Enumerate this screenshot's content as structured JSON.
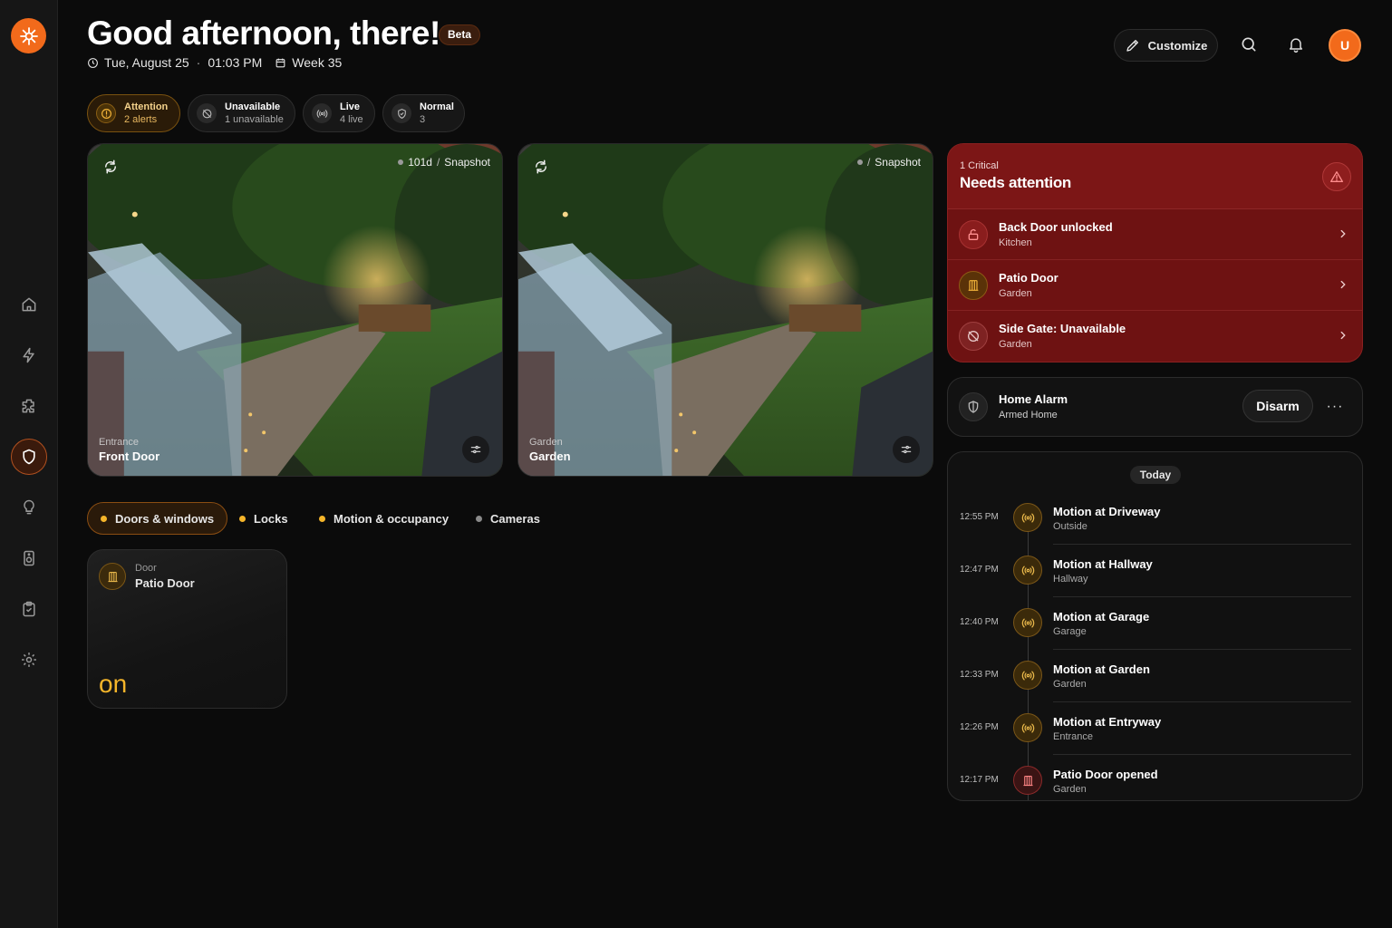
{
  "header": {
    "greeting": "Good afternoon, there!",
    "badge": "Beta",
    "date": "Tue, August 25",
    "time": "01:03 PM",
    "week": "Week 35",
    "customize_label": "Customize",
    "avatar_initial": "U"
  },
  "colors": {
    "accent": "#f26a1b",
    "attention_bg": "#6e1212",
    "amber": "#f5b52a"
  },
  "sidebar": {
    "items": [
      {
        "name": "home",
        "icon": "home-icon"
      },
      {
        "name": "automations",
        "icon": "bolt-icon"
      },
      {
        "name": "integrations",
        "icon": "puzzle-icon"
      },
      {
        "name": "security",
        "icon": "shield-icon",
        "active": true
      },
      {
        "name": "lights",
        "icon": "lightbulb-icon"
      },
      {
        "name": "media",
        "icon": "speaker-icon"
      },
      {
        "name": "tasks",
        "icon": "clipboard-icon"
      },
      {
        "name": "settings",
        "icon": "gear-icon"
      }
    ]
  },
  "status_chips": [
    {
      "title": "Attention",
      "sub": "2 alerts",
      "icon": "alert-circle-icon"
    },
    {
      "title": "Unavailable",
      "sub": "1 unavailable",
      "icon": "off-icon"
    },
    {
      "title": "Live",
      "sub": "4 live",
      "icon": "broadcast-icon"
    },
    {
      "title": "Normal",
      "sub": "3",
      "icon": "shield-check-icon"
    }
  ],
  "cameras": [
    {
      "location": "Entrance",
      "name": "Front Door",
      "age": "101d",
      "mode": "Snapshot"
    },
    {
      "location": "Garden",
      "name": "Garden",
      "age": "",
      "mode": "Snapshot"
    }
  ],
  "filters": [
    {
      "label": "Doors & windows",
      "color": "#f5b52a",
      "active": true
    },
    {
      "label": "Locks",
      "color": "#f5b52a"
    },
    {
      "label": "Motion & occupancy",
      "color": "#f5b52a"
    },
    {
      "label": "Cameras",
      "color": "#8a8a8a"
    }
  ],
  "tile": {
    "type": "Door",
    "name": "Patio Door",
    "state": "on",
    "icon": "door-icon"
  },
  "attention": {
    "critical": "1 Critical",
    "title": "Needs attention",
    "items": [
      {
        "title": "Back Door unlocked",
        "sub": "Kitchen",
        "icon": "unlock-icon"
      },
      {
        "title": "Patio Door",
        "sub": "Garden",
        "icon": "door-icon"
      },
      {
        "title": "Side Gate: Unavailable",
        "sub": "Garden",
        "icon": "off-icon"
      }
    ]
  },
  "alarm": {
    "title": "Home Alarm",
    "sub": "Armed Home",
    "action": "Disarm",
    "more": "···"
  },
  "timeline": {
    "label": "Today",
    "events": [
      {
        "time": "12:55 PM",
        "title": "Motion at Driveway",
        "sub": "Outside",
        "kind": "motion"
      },
      {
        "time": "12:47 PM",
        "title": "Motion at Hallway",
        "sub": "Hallway",
        "kind": "motion"
      },
      {
        "time": "12:40 PM",
        "title": "Motion at Garage",
        "sub": "Garage",
        "kind": "motion"
      },
      {
        "time": "12:33 PM",
        "title": "Motion at Garden",
        "sub": "Garden",
        "kind": "motion"
      },
      {
        "time": "12:26 PM",
        "title": "Motion at Entryway",
        "sub": "Entrance",
        "kind": "motion"
      },
      {
        "time": "12:17 PM",
        "title": "Patio Door opened",
        "sub": "Garden",
        "kind": "door"
      }
    ]
  }
}
